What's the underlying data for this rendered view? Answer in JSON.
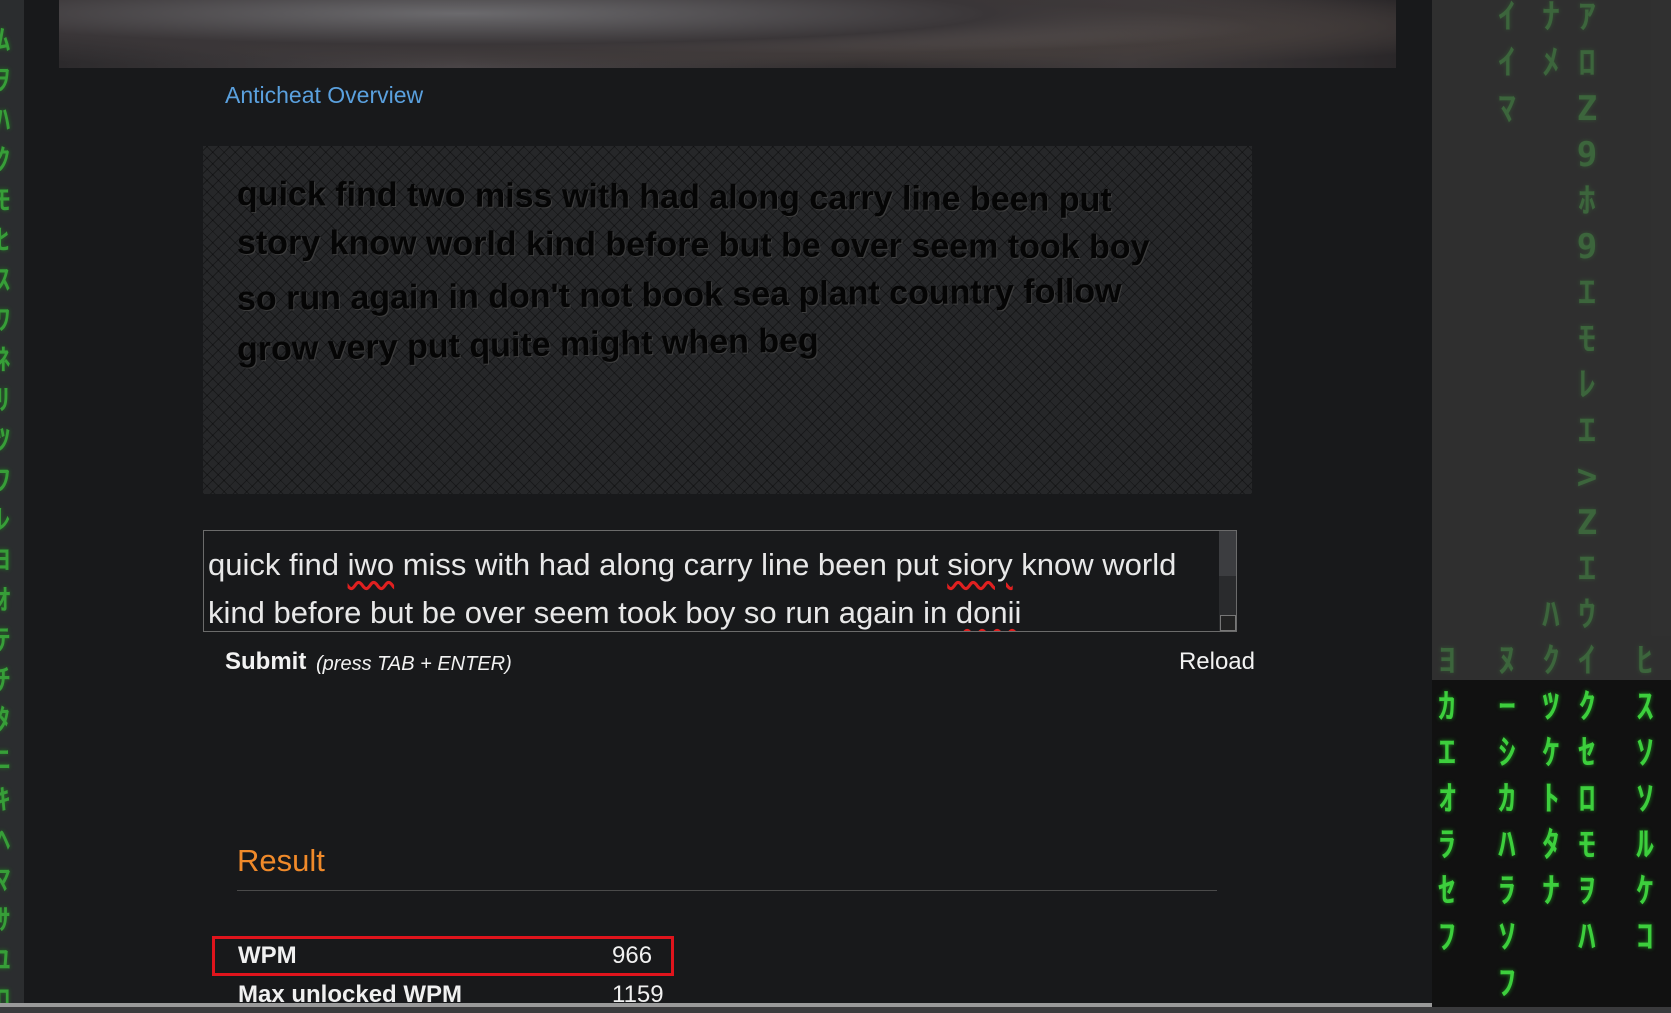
{
  "header": {
    "anticheat_link": "Anticheat Overview"
  },
  "passage": {
    "lines": [
      "quick find two miss with had along carry line been put",
      "story know world kind before but be over seem took boy",
      "so run again in don't not book sea plant country follow",
      "grow very put quite might when beg"
    ]
  },
  "typing": {
    "segments": [
      {
        "text": "quick find ",
        "misspelled": false
      },
      {
        "text": "iwo",
        "misspelled": true
      },
      {
        "text": " miss with had along carry line been put ",
        "misspelled": false
      },
      {
        "text": "siory",
        "misspelled": true
      },
      {
        "text": " know world kind before but be over seem took boy so run again in ",
        "misspelled": false
      },
      {
        "text": "donii",
        "misspelled": true
      }
    ]
  },
  "controls": {
    "submit_label": "Submit",
    "submit_hint": "(press TAB + ENTER)",
    "reload_label": "Reload"
  },
  "result": {
    "title": "Result",
    "stats": [
      {
        "label": "WPM",
        "value": "966"
      },
      {
        "label": "Max unlocked WPM",
        "value": "1159"
      }
    ]
  },
  "colors": {
    "link": "#5aa0de",
    "result_heading": "#f08a2a",
    "highlight": "#e0141c",
    "matrix_green": "#3dcf3d"
  }
}
